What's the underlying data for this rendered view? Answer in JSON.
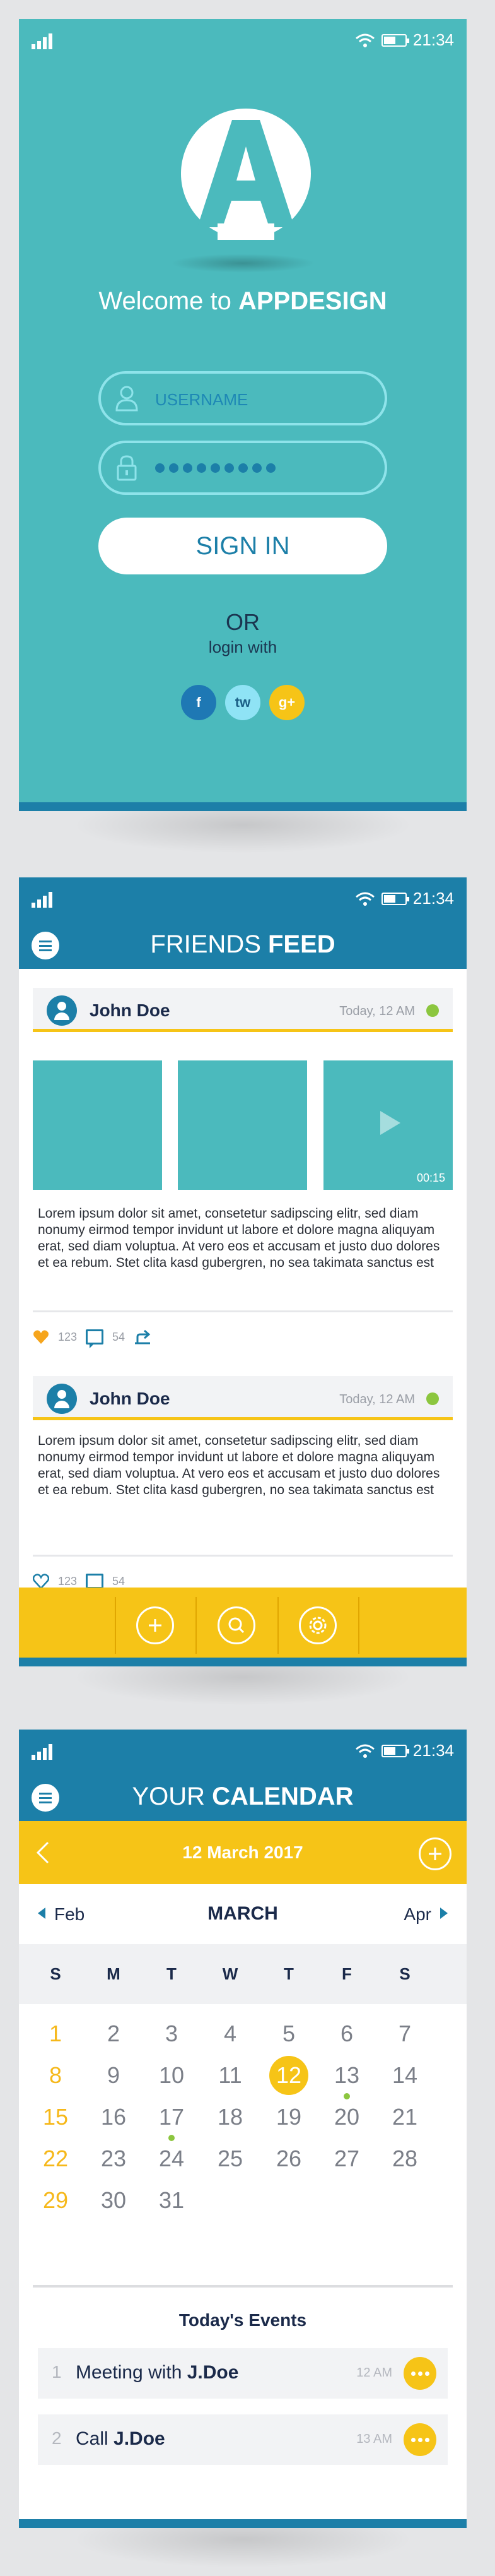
{
  "status": {
    "time": "21:34"
  },
  "colors": {
    "teal": "#4bbabd",
    "blue": "#1c7fa8",
    "yellow": "#f6c417",
    "green": "#8cc63f",
    "navy": "#1b2a4a"
  },
  "login": {
    "logo_letter": "A",
    "welcome_prefix": "Welcome to ",
    "welcome_brand": "APPDESIGN",
    "username_placeholder": "USERNAME",
    "password_dot_count": 9,
    "sign_in": "SIGN IN",
    "or": "OR",
    "login_with": "login with",
    "social": [
      {
        "label": "f",
        "icon": "facebook-icon",
        "color": "#1e78b4",
        "text_color": "#ffffff"
      },
      {
        "label": "tw",
        "icon": "twitter-icon",
        "color": "#8fe3f5",
        "text_color": "#1b5f86"
      },
      {
        "label": "g+",
        "icon": "google-plus-icon",
        "color": "#f6c417",
        "text_color": "#ffffff"
      }
    ]
  },
  "feed": {
    "title_light": "FRIENDS ",
    "title_bold": "FEED",
    "posts": [
      {
        "author": "John Doe",
        "time": "Today, 12 AM",
        "video_duration": "00:15",
        "body": "Lorem ipsum dolor sit amet, consetetur sadipscing elitr, sed diam nonumy eirmod tempor invidunt ut labore et dolore magna aliquyam erat, sed diam voluptua. At vero eos et accusam et justo duo dolores et ea rebum. Stet clita kasd gubergren, no sea takimata sanctus est",
        "likes": "123",
        "comments": "54"
      },
      {
        "author": "John Doe",
        "time": "Today, 12 AM",
        "body": "Lorem ipsum dolor sit amet, consetetur sadipscing elitr, sed diam nonumy eirmod tempor invidunt ut labore et dolore magna aliquyam erat, sed diam voluptua. At vero eos et accusam et justo duo dolores et ea rebum. Stet clita kasd gubergren, no sea takimata sanctus est",
        "likes": "123",
        "comments": "54"
      }
    ],
    "bottom_buttons": [
      "add-icon",
      "search-icon",
      "settings-icon"
    ]
  },
  "calendar": {
    "title_light": "YOUR ",
    "title_bold": "CALENDAR",
    "selected_date": "12 March 2017",
    "prev_month": "Feb",
    "current_month": "MARCH",
    "next_month": "Apr",
    "weekdays": [
      "S",
      "M",
      "T",
      "W",
      "T",
      "F",
      "S"
    ],
    "first_weekday_index": 0,
    "days_in_month": 31,
    "today": 12,
    "event_days": [
      13,
      17
    ],
    "events_title": "Today's Events",
    "events": [
      {
        "num": "1",
        "title_plain": "Meeting with ",
        "title_bold": "J.Doe",
        "time": "12 AM"
      },
      {
        "num": "2",
        "title_plain": "Call ",
        "title_bold": "J.Doe",
        "time": "13 AM"
      }
    ]
  }
}
